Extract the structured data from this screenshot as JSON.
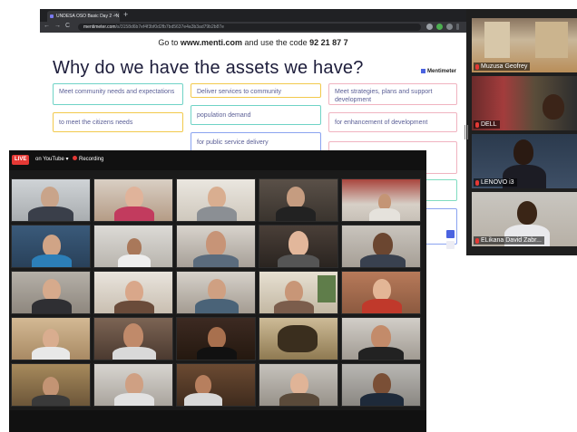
{
  "browser": {
    "tab_title": "UNDESA OSO Basic Day 2 - N",
    "tab_close": "×",
    "new_tab": "+",
    "url_host": "mentimeter.com",
    "url_path": "/s/3158d6b7ef4f3bf0d2fb7bd5637e4a3b3ad79b2b87e",
    "back": "←",
    "forward": "→",
    "reload": "C"
  },
  "mentimeter": {
    "join_prefix": "Go to ",
    "join_site": "www.menti.com",
    "join_mid": " and use the code ",
    "join_code": "92 21 87 7",
    "question": "Why do we have the assets we have?",
    "logo": "Mentimeter",
    "cards": [
      {
        "text": "Meet community needs and expectations"
      },
      {
        "text": "Deliver services to community"
      },
      {
        "text": "Meet strategies, plans and support development"
      },
      {
        "text": "to meet the citizens needs"
      },
      {
        "text": "population demand"
      },
      {
        "text": "for enhancement of development"
      },
      {
        "text": "for public service delivery"
      },
      {
        "text": ""
      },
      {
        "text": ""
      }
    ]
  },
  "side_participants": [
    {
      "name": "Muzusa Geofrey"
    },
    {
      "name": "DELL"
    },
    {
      "name": "LENOVO i3"
    },
    {
      "name": "ELikana David Zabr..."
    }
  ],
  "zoom": {
    "live_label": "LIVE",
    "stream_target": "on YouTube",
    "recording_label": "Recording",
    "dropdown_arrow": "▾"
  },
  "colors": {
    "live_red": "#e53935",
    "menti_blue": "#4b63e0",
    "question_text": "#1d1d3b",
    "card_text": "#5b5f96"
  }
}
